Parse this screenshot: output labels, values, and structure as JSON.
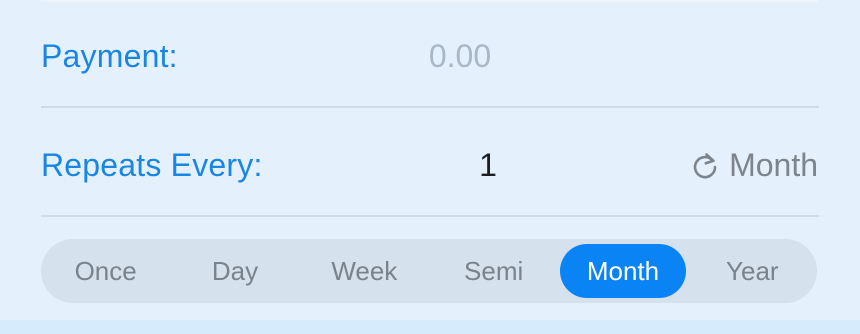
{
  "payment": {
    "label": "Payment:",
    "placeholder": "0.00"
  },
  "repeat": {
    "label": "Repeats Every:",
    "value": "1",
    "unit_icon": "repeat-icon",
    "unit_label": "Month"
  },
  "frequency": {
    "options": [
      "Once",
      "Day",
      "Week",
      "Semi",
      "Month",
      "Year"
    ],
    "selected": "Month"
  },
  "colors": {
    "accent": "#0a84f5",
    "label": "#1a86e3",
    "background": "#e4f0fc"
  }
}
